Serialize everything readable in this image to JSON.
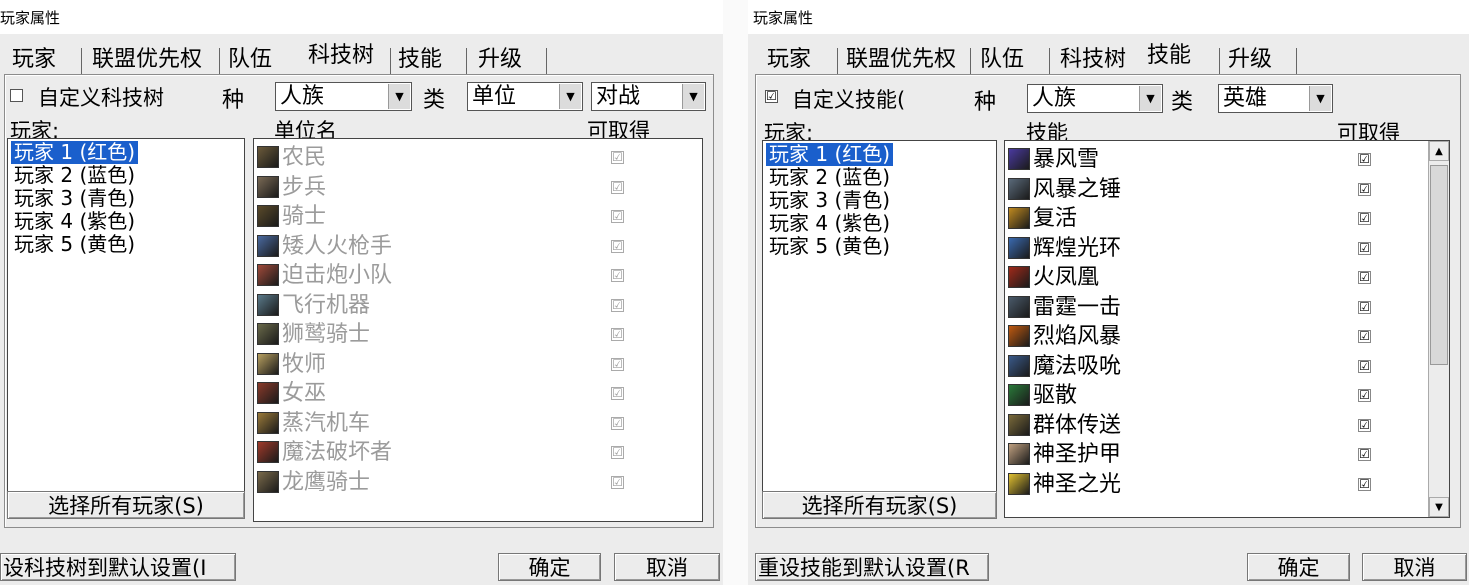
{
  "left": {
    "title": "玩家属性",
    "tabs": [
      "玩家",
      "联盟优先权",
      "队伍",
      "科技树",
      "技能",
      "升级"
    ],
    "selected_tab": 3,
    "custom_checkbox_label": "自定义科技树",
    "custom_checked": false,
    "race_label": "种",
    "race_value": "人族",
    "type_label": "类",
    "type_value": "单位",
    "mode_value": "对战",
    "players_label": "玩家:",
    "players": [
      "玩家 1 (红色)",
      "玩家 2 (蓝色)",
      "玩家 3 (青色)",
      "玩家 4 (紫色)",
      "玩家 5 (黄色)"
    ],
    "list_header": "单位名",
    "avail_header": "可取得",
    "items": [
      {
        "name": "农民",
        "icon_color": "#6b5a3a"
      },
      {
        "name": "步兵",
        "icon_color": "#7a6a55"
      },
      {
        "name": "骑士",
        "icon_color": "#5a4a2a"
      },
      {
        "name": "矮人火枪手",
        "icon_color": "#4a6aa0"
      },
      {
        "name": "迫击炮小队",
        "icon_color": "#a04a3a"
      },
      {
        "name": "飞行机器",
        "icon_color": "#5a7a8a"
      },
      {
        "name": "狮鹫骑士",
        "icon_color": "#6a6a4a"
      },
      {
        "name": "牧师",
        "icon_color": "#b8a060"
      },
      {
        "name": "女巫",
        "icon_color": "#8a3a2a"
      },
      {
        "name": "蒸汽机车",
        "icon_color": "#9a7a3a"
      },
      {
        "name": "魔法破坏者",
        "icon_color": "#a03a2a"
      },
      {
        "name": "龙鹰骑士",
        "icon_color": "#7a6a4a"
      }
    ],
    "check_mark": "☑",
    "select_all": "选择所有玩家(S)",
    "reset": "设科技树到默认设置(I",
    "ok": "确定",
    "cancel": "取消"
  },
  "right": {
    "title": "玩家属性",
    "tabs": [
      "玩家",
      "联盟优先权",
      "队伍",
      "科技树",
      "技能",
      "升级"
    ],
    "selected_tab": 4,
    "custom_checkbox_label": "自定义技能(",
    "custom_checked": true,
    "race_label": "种",
    "race_value": "人族",
    "type_label": "类",
    "type_value": "英雄",
    "players_label": "玩家:",
    "players": [
      "玩家 1 (红色)",
      "玩家 2 (蓝色)",
      "玩家 3 (青色)",
      "玩家 4 (紫色)",
      "玩家 5 (黄色)"
    ],
    "list_header": "技能",
    "avail_header": "可取得",
    "items": [
      {
        "name": "暴风雪",
        "icon_color": "#4a3aa0"
      },
      {
        "name": "风暴之锤",
        "icon_color": "#5a6a7a"
      },
      {
        "name": "复活",
        "icon_color": "#c08a20"
      },
      {
        "name": "辉煌光环",
        "icon_color": "#3a6ab0"
      },
      {
        "name": "火凤凰",
        "icon_color": "#a02a1a"
      },
      {
        "name": "雷霆一击",
        "icon_color": "#4a5a6a"
      },
      {
        "name": "烈焰风暴",
        "icon_color": "#c05a10"
      },
      {
        "name": "魔法吸吮",
        "icon_color": "#3a5a8a"
      },
      {
        "name": "驱散",
        "icon_color": "#2a7a3a"
      },
      {
        "name": "群体传送",
        "icon_color": "#7a6a3a"
      },
      {
        "name": "神圣护甲",
        "icon_color": "#c0a080"
      },
      {
        "name": "神圣之光",
        "icon_color": "#e0c030"
      }
    ],
    "check_mark": "☑",
    "select_all": "选择所有玩家(S)",
    "reset": "重设技能到默认设置(R",
    "ok": "确定",
    "cancel": "取消"
  }
}
